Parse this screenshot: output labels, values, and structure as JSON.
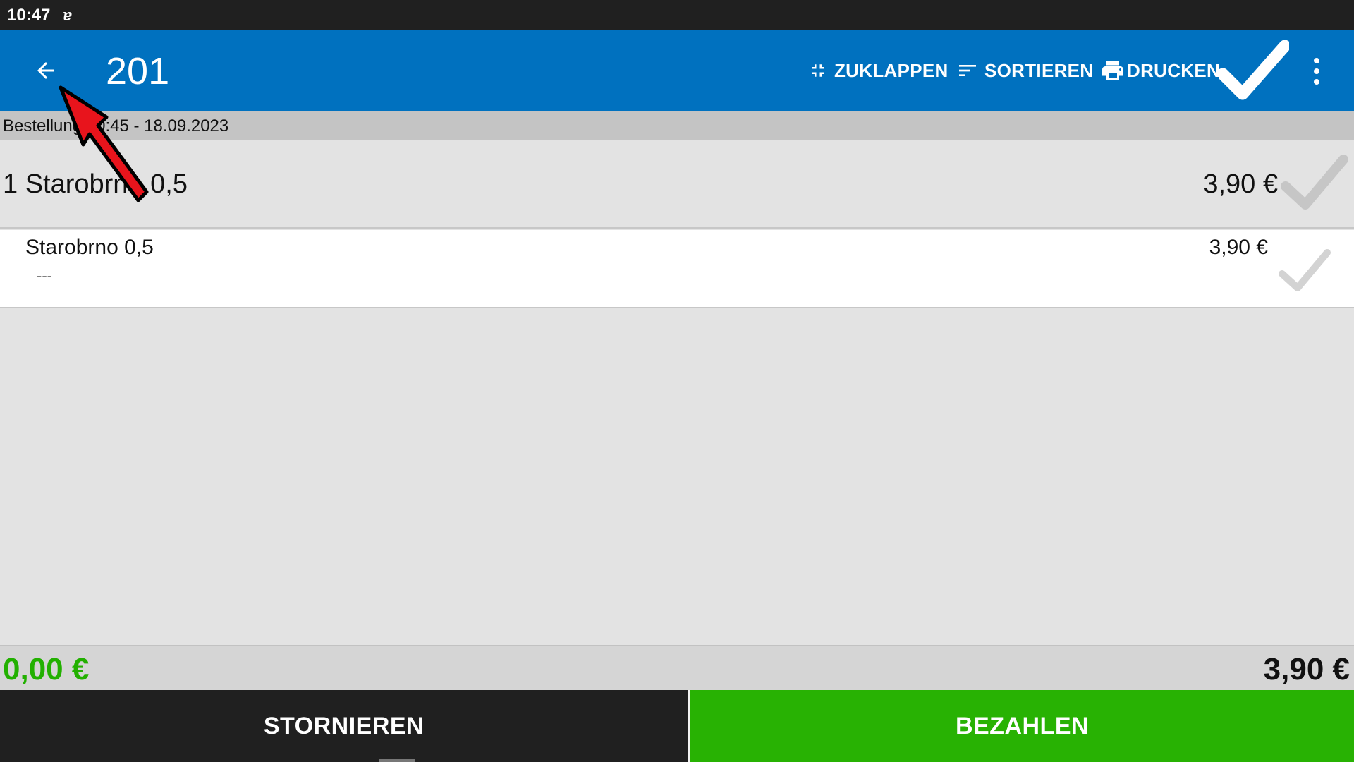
{
  "status_bar": {
    "time": "10:47",
    "icon": "app-notification-icon",
    "icon_glyph": "ɐ"
  },
  "app_bar": {
    "title": "201",
    "actions": {
      "collapse_label": "ZUKLAPPEN",
      "sort_label": "SORTIEREN",
      "print_label": "DRUCKEN"
    },
    "icons": [
      "back-arrow-icon",
      "collapse-icon",
      "sort-icon",
      "printer-icon",
      "checkmark-icon",
      "more-vertical-icon"
    ]
  },
  "order": {
    "header": "Bestellung 10:45 - 18.09.2023",
    "group": {
      "name": "1 Starobrno 0,5",
      "price": "3,90 €"
    },
    "items": [
      {
        "name": "Starobrno 0,5",
        "note": "---",
        "price": "3,90 €"
      }
    ]
  },
  "totals": {
    "paid": "0,00 €",
    "open": "3,90 €"
  },
  "footer": {
    "cancel_label": "STORNIEREN",
    "pay_label": "BEZAHLEN"
  },
  "colors": {
    "app_bar": "#0071bf",
    "pay_button": "#28b203",
    "paid_total": "#22b000",
    "annotation_arrow": "#e8141c"
  }
}
